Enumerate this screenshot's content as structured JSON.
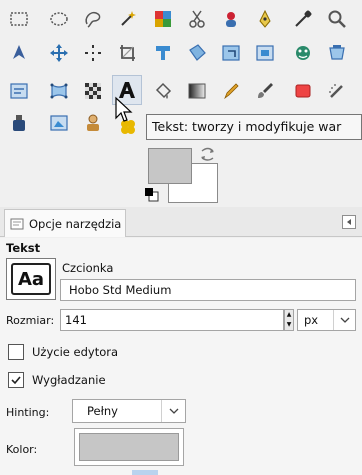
{
  "toolbox": {
    "tools": [
      {
        "name": "rect-select-icon",
        "color": "#555"
      },
      {
        "name": "ellipse-select-icon",
        "color": "#555"
      },
      {
        "name": "free-select-icon",
        "color": "#555"
      },
      {
        "name": "fuzzy-select-icon",
        "color": "#d9a400"
      },
      {
        "name": "color-select-icon",
        "color": "#d33"
      },
      {
        "name": "scissors-select-icon",
        "color": "#555"
      },
      {
        "name": "foreground-select-icon",
        "color": "#c23"
      },
      {
        "name": "paths-icon",
        "color": "#caa000"
      },
      {
        "name": "color-picker-icon",
        "color": "#333"
      },
      {
        "name": "zoom-icon",
        "color": "#555"
      },
      {
        "name": "measure-icon",
        "color": "#3a5f9c"
      },
      {
        "name": "move-icon",
        "color": "#2a6fb0"
      },
      {
        "name": "alignment-icon",
        "color": "#333"
      },
      {
        "name": "crop-icon",
        "color": "#555"
      },
      {
        "name": "rotate-icon",
        "color": "#3a8bd0"
      },
      {
        "name": "scale-icon",
        "color": "#3a8bd0"
      },
      {
        "name": "shear-icon",
        "color": "#3a8bd0"
      },
      {
        "name": "perspective-icon",
        "color": "#3a8bd0"
      },
      {
        "name": "flip-icon",
        "color": "#2a8a6a"
      },
      {
        "name": "cage-transform-icon",
        "color": "#3a6fb0"
      },
      {
        "name": "unified-transform-icon",
        "color": "#3a6fb0"
      },
      {
        "name": "warp-transform-icon",
        "color": "#3a6fb0"
      },
      {
        "name": "checkerboard-icon",
        "color": "#333"
      },
      {
        "name": "text-tool-icon",
        "color": "#111"
      },
      {
        "name": "bucket-fill-icon",
        "color": "#555"
      },
      {
        "name": "blend-icon",
        "color": "#555"
      },
      {
        "name": "pencil-icon",
        "color": "#d99000"
      },
      {
        "name": "paintbrush-icon",
        "color": "#555"
      },
      {
        "name": "eraser-icon",
        "color": "#d33"
      },
      {
        "name": "airbrush-icon",
        "color": "#555"
      },
      {
        "name": "ink-icon",
        "color": "#2a4a7a"
      },
      {
        "name": "mypaint-brush-icon",
        "color": "#3a8bd0"
      },
      {
        "name": "clone-icon",
        "color": "#c58b3a"
      },
      {
        "name": "heal-icon",
        "color": "#d9a400"
      }
    ],
    "tooltip": "Tekst: tworzy i modyfikuje war",
    "colors": {
      "foreground": "#c6c6c6",
      "background": "#ffffff"
    }
  },
  "dock": {
    "tab_label": "Opcje narzędzia",
    "tab_icon": "tool-options-icon",
    "menu_icon": "tab-menu-icon"
  },
  "options": {
    "section_title": "Tekst",
    "font_preview_text": "Aa",
    "font_label": "Czcionka",
    "font_value": "Hobo Std Medium",
    "size_label": "Rozmiar:",
    "size_value": "141",
    "unit_value": "px",
    "editor_label": "Użycie edytora",
    "editor_checked": false,
    "antialias_label": "Wygładzanie",
    "antialias_checked": true,
    "hinting_label": "Hinting:",
    "hinting_value": "Pełny",
    "color_label": "Kolor:",
    "color_value": "#c6c6c6"
  }
}
